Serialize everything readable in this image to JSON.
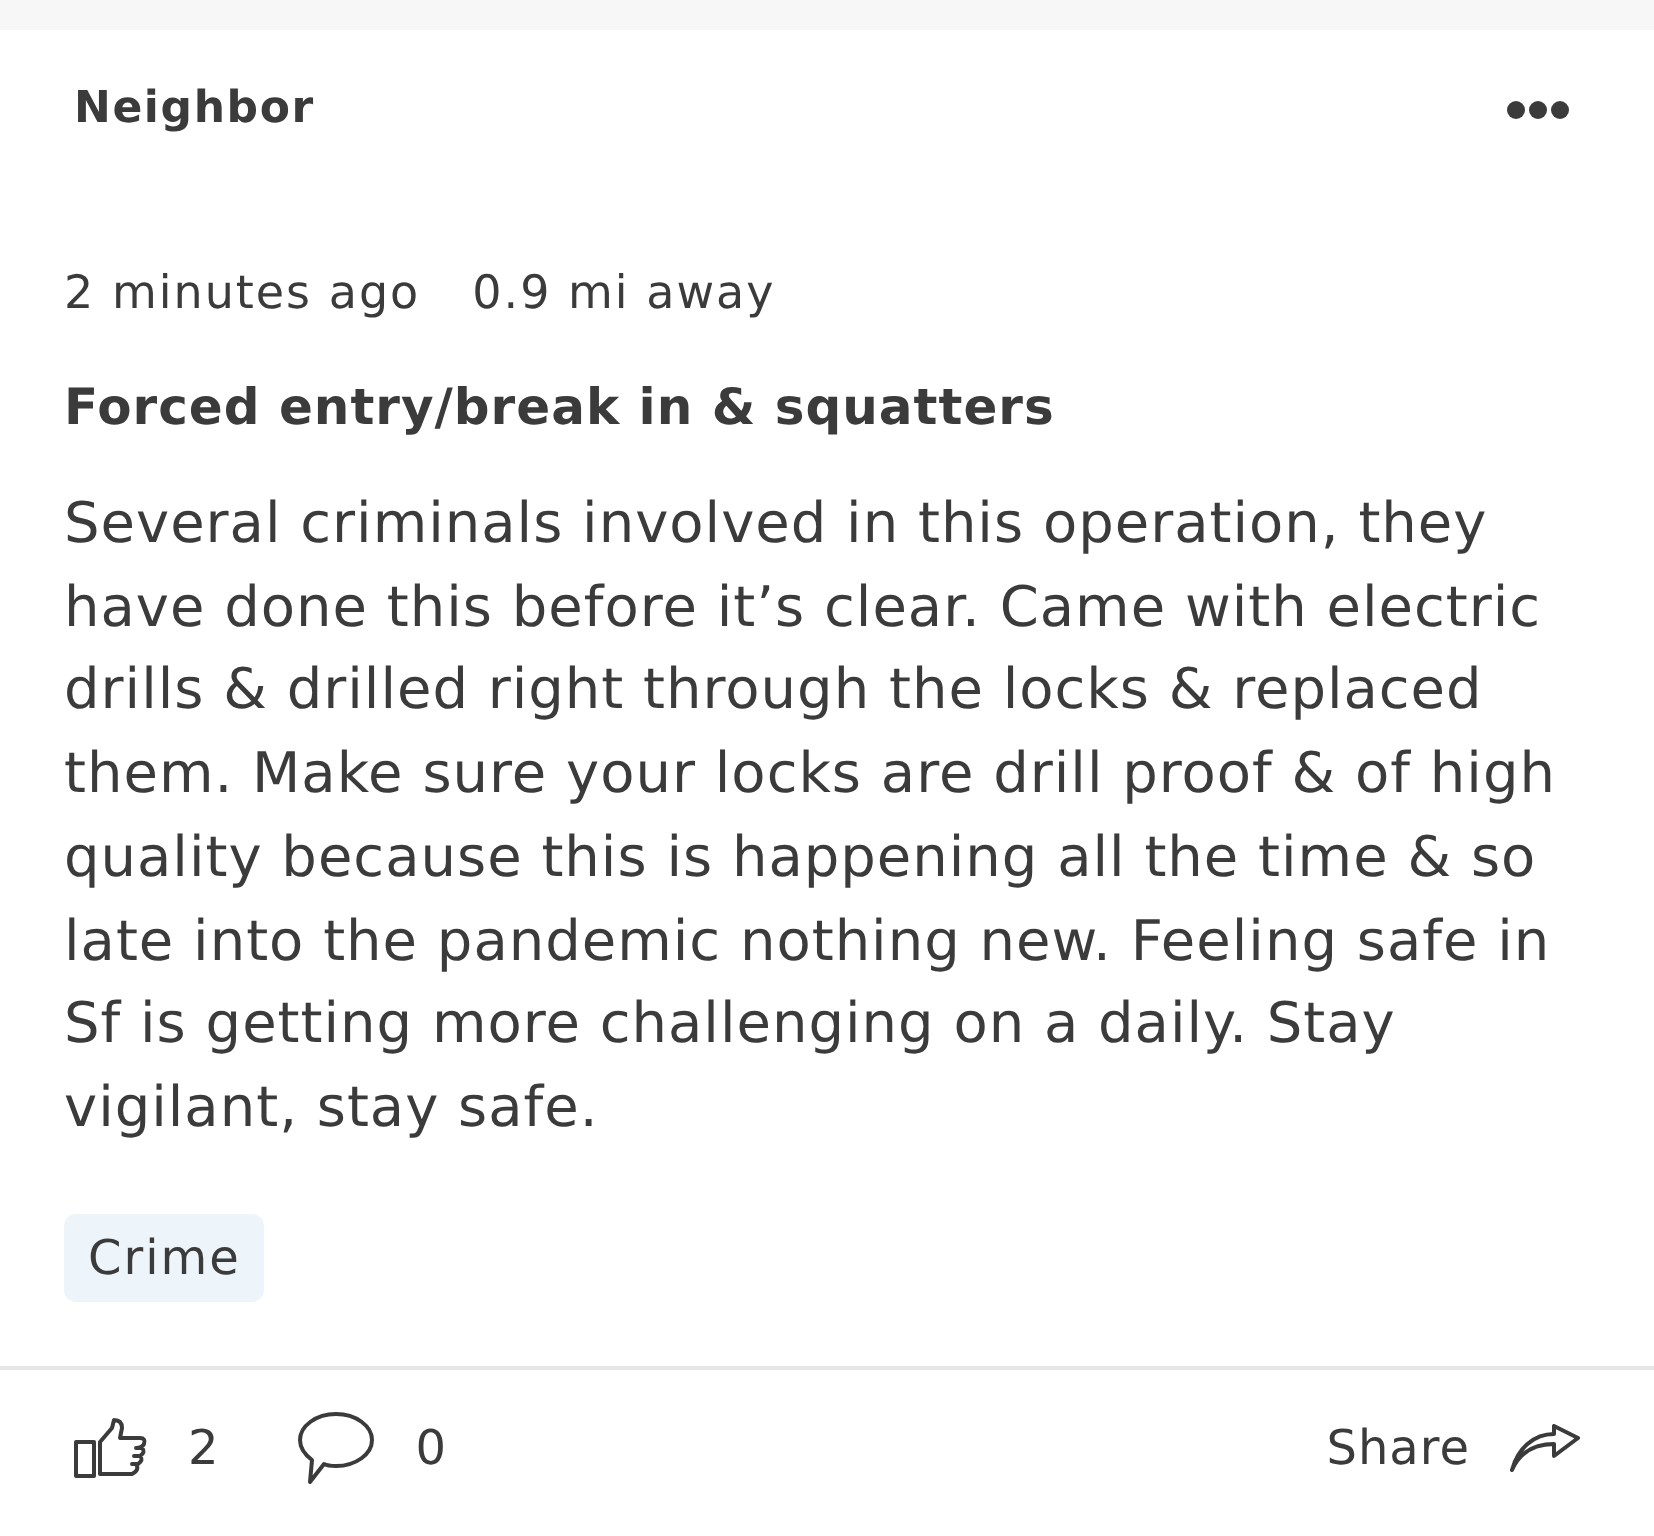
{
  "post": {
    "author": "Neighbor",
    "time": "2 minutes ago",
    "distance": "0.9 mi away",
    "title": "Forced entry/break in & squatters",
    "body": "Several criminals involved in this operation, they have done this before it’s clear. Came with electric drills & drilled right through the locks & replaced them. Make sure your locks are drill proof & of high quality because this is happening all the time & so late into the pandemic nothing new. Feeling safe in Sf is getting more challenging on a daily. Stay vigilant, stay safe.",
    "tags": [
      "Crime"
    ]
  },
  "actions": {
    "likes": "2",
    "comments": "0",
    "share": "Share"
  }
}
